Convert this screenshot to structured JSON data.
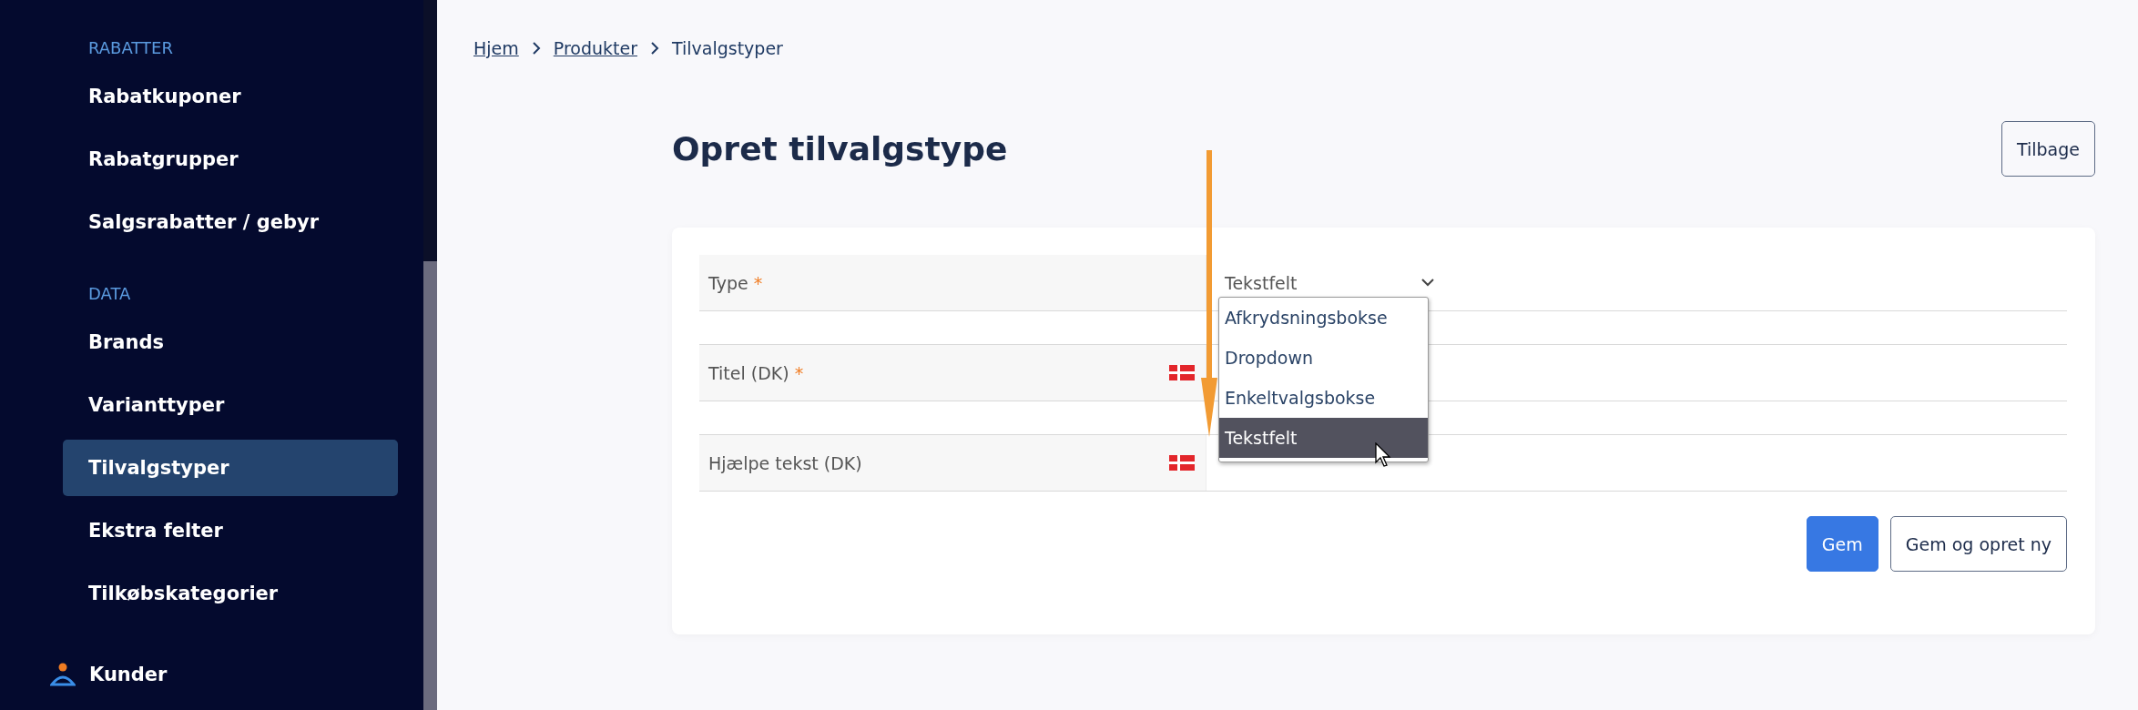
{
  "sidebar": {
    "sections": [
      {
        "heading": "RABATTER",
        "items": [
          {
            "label": "Rabatkuponer",
            "selected": false
          },
          {
            "label": "Rabatgrupper",
            "selected": false
          },
          {
            "label": "Salgsrabatter / gebyr",
            "selected": false
          }
        ]
      },
      {
        "heading": "DATA",
        "items": [
          {
            "label": "Brands",
            "selected": false
          },
          {
            "label": "Varianttyper",
            "selected": false
          },
          {
            "label": "Tilvalgstyper",
            "selected": true
          },
          {
            "label": "Ekstra felter",
            "selected": false
          },
          {
            "label": "Tilkøbskategorier",
            "selected": false
          }
        ]
      }
    ],
    "bottom_item": {
      "label": "Kunder"
    }
  },
  "breadcrumb": [
    {
      "label": "Hjem",
      "kind": "link"
    },
    {
      "label": "Produkter",
      "kind": "link"
    },
    {
      "label": "Tilvalgstyper",
      "kind": "current"
    }
  ],
  "page": {
    "title": "Opret tilvalgstype",
    "back_button": "Tilbage"
  },
  "form": {
    "required_marker": "*",
    "fields": [
      {
        "label": "Type",
        "required": true,
        "flag": false,
        "kind": "select",
        "value": "Tekstfelt",
        "expanded": true,
        "options": [
          {
            "label": "Afkrydsningsbokse",
            "selected": false
          },
          {
            "label": "Dropdown",
            "selected": false
          },
          {
            "label": "Enkeltvalgsbokse",
            "selected": false
          },
          {
            "label": "Tekstfelt",
            "selected": true
          }
        ]
      },
      {
        "label": "Titel (DK)",
        "required": true,
        "flag": true,
        "kind": "text"
      },
      {
        "label": "Hjælpe tekst (DK)",
        "required": false,
        "flag": true,
        "kind": "text"
      }
    ],
    "buttons": [
      {
        "label": "Gem",
        "kind": "primary"
      },
      {
        "label": "Gem og opret ny",
        "kind": "secondary"
      }
    ]
  }
}
